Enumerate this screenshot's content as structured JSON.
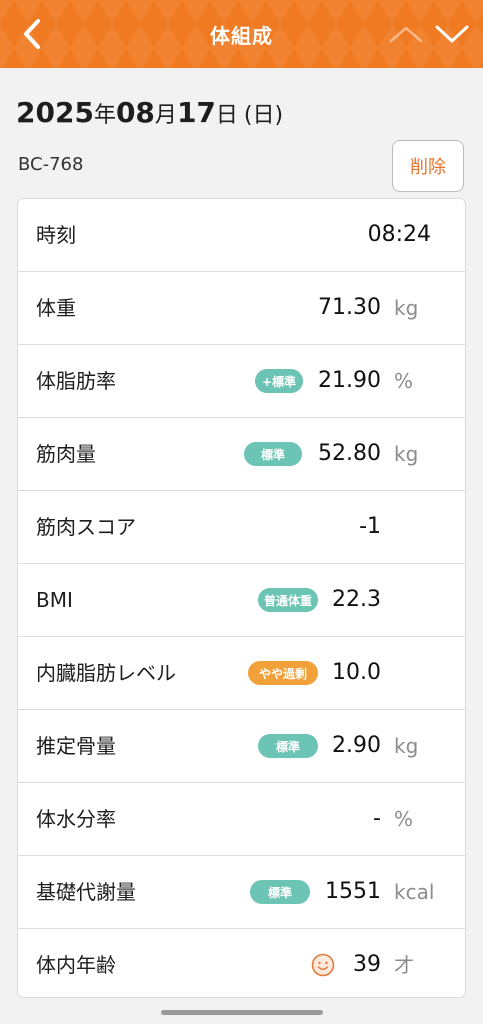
{
  "header": {
    "title": "体組成",
    "back_icon": "chevron-left-icon",
    "prev_icon": "chevron-up-icon",
    "next_icon": "chevron-down-icon",
    "color": "#f07a22"
  },
  "date": {
    "year": "2025",
    "year_suffix": "年",
    "month": "08",
    "month_suffix": "月",
    "day": "17",
    "day_suffix": "日",
    "weekday": "(日)"
  },
  "device": {
    "model": "BC-768",
    "delete_label": "削除"
  },
  "rows": [
    {
      "label": "時刻",
      "value": "08:24",
      "unit": "",
      "badge": ""
    },
    {
      "label": "体重",
      "value": "71.30",
      "unit": "kg",
      "badge": ""
    },
    {
      "label": "体脂肪率",
      "value": "21.90",
      "unit": "%",
      "badge": "+標準",
      "badge_color": "#6bc4b4"
    },
    {
      "label": "筋肉量",
      "value": "52.80",
      "unit": "kg",
      "badge": "標準",
      "badge_color": "#6bc4b4"
    },
    {
      "label": "筋肉スコア",
      "value": "-1",
      "unit": "",
      "badge": ""
    },
    {
      "label": "BMI",
      "value": "22.3",
      "unit": "",
      "badge": "普通体重",
      "badge_color": "#6bc4b4"
    },
    {
      "label": "内臓脂肪レベル",
      "value": "10.0",
      "unit": "",
      "badge": "やや過剰",
      "badge_color": "#f2a03a"
    },
    {
      "label": "推定骨量",
      "value": "2.90",
      "unit": "kg",
      "badge": "標準",
      "badge_color": "#6bc4b4"
    },
    {
      "label": "体水分率",
      "value": "-",
      "unit": "%",
      "badge": ""
    },
    {
      "label": "基礎代謝量",
      "value": "1551",
      "unit": "kcal",
      "badge": "標準",
      "badge_color": "#6bc4b4"
    },
    {
      "label": "体内年齢",
      "value": "39",
      "unit": "才",
      "badge": "",
      "icon": "smiley-face-icon"
    }
  ]
}
